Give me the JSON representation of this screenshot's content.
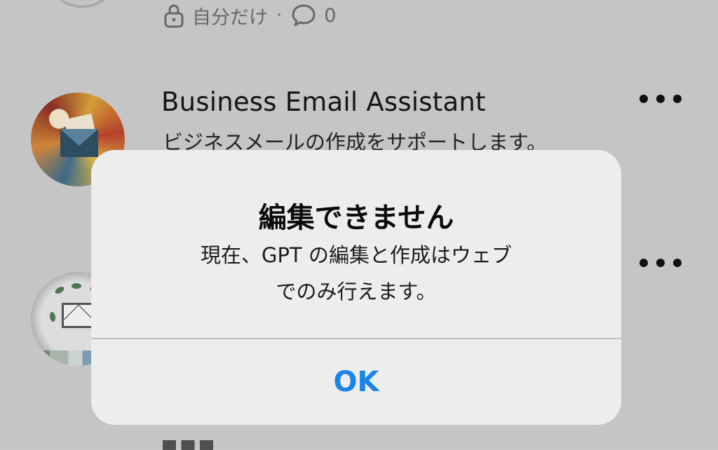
{
  "list": {
    "previous_item": {
      "visibility_label": "自分だけ",
      "separator": "·",
      "comment_count": "0",
      "icons": {
        "visibility": "lock-icon",
        "comments": "comment-icon"
      }
    },
    "items": [
      {
        "title": "Business Email Assistant",
        "description": "ビジネスメールの作成をサポートします。",
        "menu_icon": "more-horizontal-icon"
      },
      {
        "menu_icon": "more-horizontal-icon"
      }
    ]
  },
  "dialog": {
    "title": "編集できません",
    "message_line1": "現在、GPT の編集と作成はウェブ",
    "message_line2": "でのみ行えます。",
    "ok_label": "OK"
  },
  "colors": {
    "background": "#c9c9c9",
    "dialog_background": "#ededed",
    "accent": "#1a84e8",
    "meta_text": "#6b6b6b"
  }
}
